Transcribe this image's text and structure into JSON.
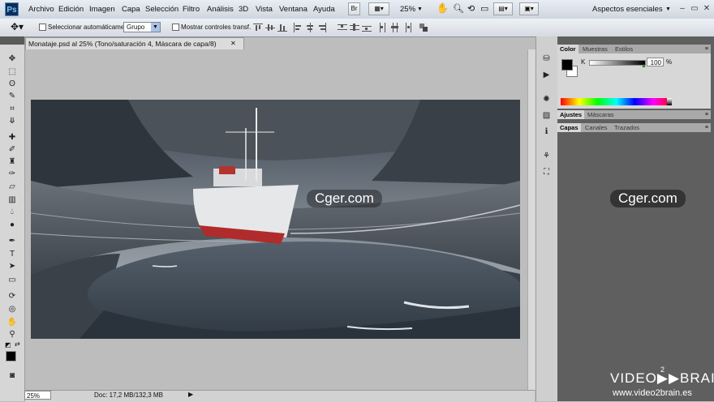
{
  "menubar": {
    "logo": "Ps",
    "items": [
      "Archivo",
      "Edición",
      "Imagen",
      "Capa",
      "Selección",
      "Filtro",
      "Análisis",
      "3D",
      "Vista",
      "Ventana",
      "Ayuda"
    ],
    "bridge_label": "Br",
    "zoom": "25%",
    "workspace": "Aspectos esenciales",
    "window_controls": [
      "–",
      "▭",
      "✕"
    ]
  },
  "options": {
    "auto_select_label": "Seleccionar automáticamente:",
    "auto_select_value": "Grupo",
    "show_transform_label": "Mostrar controles transf."
  },
  "document": {
    "tab_title": "Monataje.psd al 25% (Tono/saturación 4, Máscara de capa/8)",
    "close": "✕"
  },
  "status": {
    "zoom": "25%",
    "doc_info": "Doc: 17,2 MB/132,3 MB"
  },
  "panels": {
    "color_tabs": [
      "Color",
      "Muestras",
      "Estilos"
    ],
    "channel_label": "K",
    "k_value": "100",
    "percent": "%",
    "adjust_tabs": [
      "Ajustes",
      "Máscaras"
    ],
    "layers_tabs": [
      "Capas",
      "Canales",
      "Trazados"
    ]
  },
  "watermarks": {
    "canvas": "Cger.com",
    "right": "Cger.com",
    "brand": "VIDEO▶▶BRAIN",
    "brand_sup": "2",
    "url": "www.video2brain.es"
  },
  "colors": {
    "foreground": "#000000",
    "background": "#ffffff",
    "accent": "#0d2e55"
  }
}
